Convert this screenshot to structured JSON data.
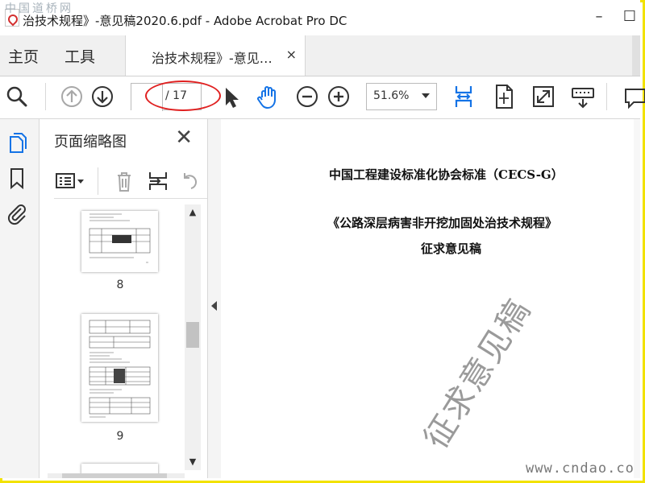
{
  "window": {
    "title": "治技术规程》-意见稿2020.6.pdf - Adobe Acrobat Pro DC",
    "watermark_top": "中国道桥网",
    "minimize": "–",
    "restore": "☐"
  },
  "tabs": {
    "home": "主页",
    "tools": "工具",
    "document": "治技术规程》-意见…",
    "close": "×"
  },
  "toolbar": {
    "page_current": "",
    "page_total": "/ 17",
    "zoom": "51.6%"
  },
  "thumbnails": {
    "title": "页面缩略图",
    "close": "✕",
    "items": [
      {
        "label": "8"
      },
      {
        "label": "9"
      }
    ],
    "scroll_up": "▲",
    "scroll_down": "▼"
  },
  "document": {
    "line1": "中国工程建设标准化协会标准（CECS-G）",
    "line2": "《公路深层病害非开挖加固处治技术规程》",
    "line3": "征求意见稿",
    "stamp": "征求意见稿",
    "site": "www.cndao.com"
  },
  "colors": {
    "frame": "#f2e200",
    "accent_blue": "#1473e6",
    "annotation_red": "#e02020"
  }
}
